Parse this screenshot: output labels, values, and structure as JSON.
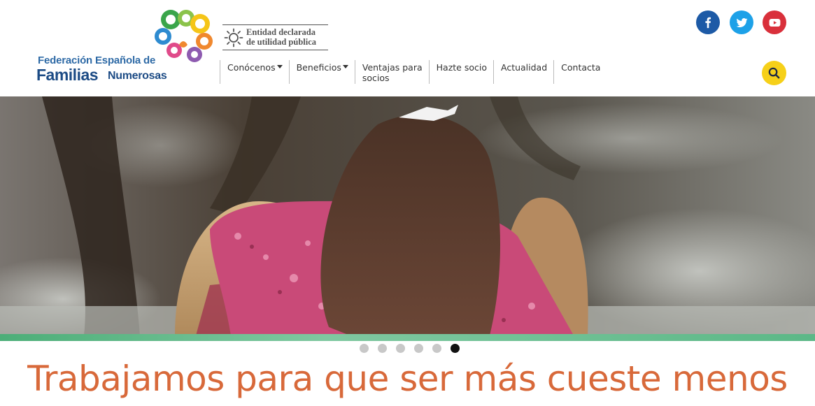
{
  "logo": {
    "line1": "Federación Española de",
    "line2": "Familias",
    "line3": "Numerosas"
  },
  "badge": {
    "line1": "Entidad declarada",
    "line2": "de utilidad pública"
  },
  "nav": {
    "items": [
      {
        "label": "Conócenos",
        "dropdown": true
      },
      {
        "label": "Beneficios",
        "dropdown": true
      },
      {
        "label_line1": "Ventajas para",
        "label_line2": "socios"
      },
      {
        "label": "Hazte socio"
      },
      {
        "label": "Actualidad"
      },
      {
        "label": "Contacta"
      }
    ]
  },
  "social": {
    "facebook_icon": "facebook-icon",
    "twitter_icon": "twitter-icon",
    "youtube_icon": "youtube-icon"
  },
  "carousel": {
    "slide_count": 6,
    "active_index": 5
  },
  "headline": "Trabajamos para que ser más cueste menos",
  "colors": {
    "brand_blue": "#1c4b85",
    "facebook": "#1d5aa6",
    "twitter": "#1da1e8",
    "youtube": "#d9303b",
    "search": "#f6d019",
    "headline": "#d8693a",
    "strip": "#4cae78"
  }
}
